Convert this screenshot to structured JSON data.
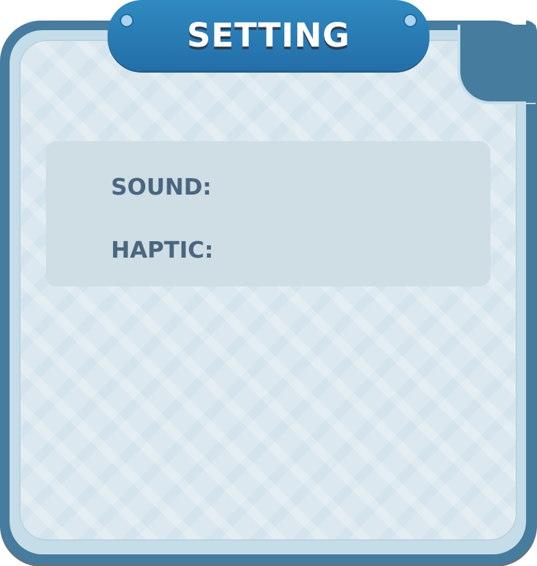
{
  "panel": {
    "title": "SETTING"
  },
  "settings": {
    "sound_label": "SOUND:",
    "haptic_label": "HAPTIC:"
  },
  "colors": {
    "frame": "#467c9e",
    "banner": "#2a7db5",
    "panel_bg": "#dbe8ef",
    "settings_box": "#cfdde4",
    "label_text": "#4a6680"
  }
}
